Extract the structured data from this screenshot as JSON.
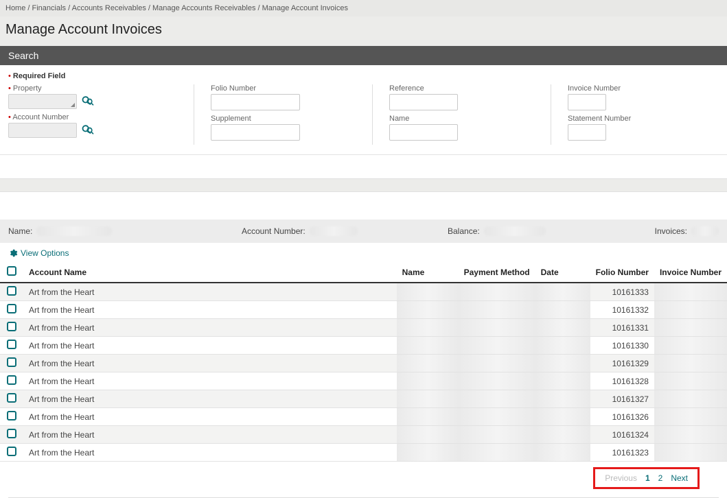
{
  "breadcrumb": {
    "items": [
      "Home",
      "Financials",
      "Accounts Receivables",
      "Manage Accounts Receivables",
      "Manage Account Invoices"
    ]
  },
  "page_title": "Manage Account Invoices",
  "search": {
    "header": "Search",
    "required_note": "Required Field",
    "labels": {
      "property": "Property",
      "account_number": "Account Number",
      "folio_number": "Folio Number",
      "supplement": "Supplement",
      "reference": "Reference",
      "name": "Name",
      "invoice_number": "Invoice Number",
      "statement_number": "Statement Number"
    }
  },
  "summary": {
    "name_label": "Name:",
    "account_label": "Account Number:",
    "balance_label": "Balance:",
    "invoices_label": "Invoices:"
  },
  "view_options_label": "View Options",
  "columns": {
    "account_name": "Account Name",
    "name": "Name",
    "payment_method": "Payment Method",
    "date": "Date",
    "folio_number": "Folio Number",
    "invoice_number": "Invoice Number"
  },
  "rows": [
    {
      "account_name": "Art from the Heart",
      "folio": "10161333"
    },
    {
      "account_name": "Art from the Heart",
      "folio": "10161332"
    },
    {
      "account_name": "Art from the Heart",
      "folio": "10161331"
    },
    {
      "account_name": "Art from the Heart",
      "folio": "10161330"
    },
    {
      "account_name": "Art from the Heart",
      "folio": "10161329"
    },
    {
      "account_name": "Art from the Heart",
      "folio": "10161328"
    },
    {
      "account_name": "Art from the Heart",
      "folio": "10161327"
    },
    {
      "account_name": "Art from the Heart",
      "folio": "10161326"
    },
    {
      "account_name": "Art from the Heart",
      "folio": "10161324"
    },
    {
      "account_name": "Art from the Heart",
      "folio": "10161323"
    }
  ],
  "pager": {
    "previous": "Previous",
    "pages": [
      "1",
      "2"
    ],
    "next": "Next"
  }
}
